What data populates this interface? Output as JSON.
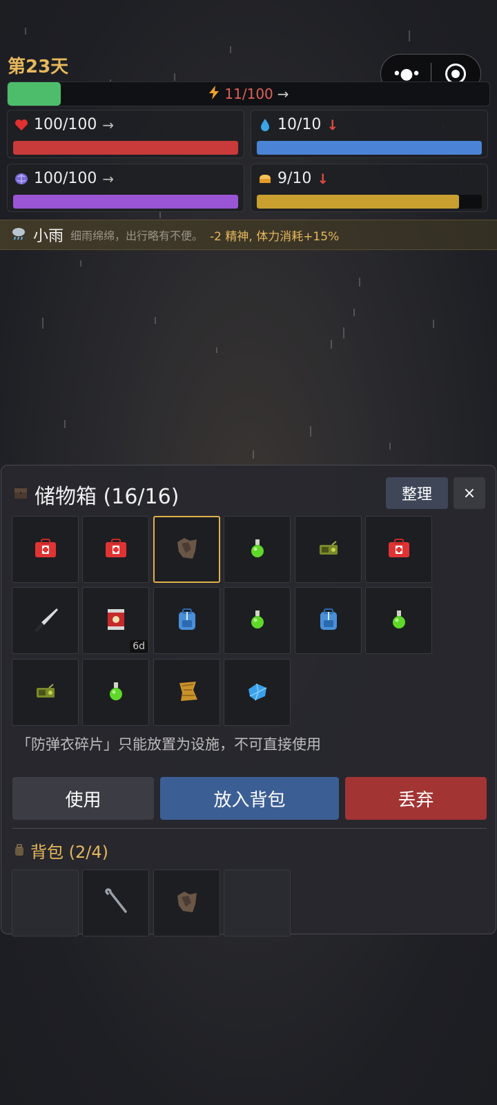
{
  "hud": {
    "day": "第23天",
    "energy": {
      "text": "11/100",
      "arrow": "→",
      "fraction": 0.11
    },
    "stats": [
      {
        "icon": "heart-icon",
        "text": "100/100",
        "dir": "→",
        "fraction": 1.0,
        "color": "#c93a3a"
      },
      {
        "icon": "water-drop-icon",
        "text": "10/10",
        "dir": "↓",
        "fraction": 1.0,
        "color": "#4b84d6"
      },
      {
        "icon": "brain-icon",
        "text": "100/100",
        "dir": "→",
        "fraction": 1.0,
        "color": "#9a55d4"
      },
      {
        "icon": "bread-icon",
        "text": "9/10",
        "dir": "↓",
        "fraction": 0.9,
        "color": "#c9a030"
      }
    ]
  },
  "capsule": {
    "more": "•●•"
  },
  "weather": {
    "icon": "rain-cloud-icon",
    "name": "小雨",
    "desc": "细雨绵绵，出行略有不便。",
    "effect": "-2 精神, 体力消耗+15%"
  },
  "storage": {
    "title": "储物箱 (16/16)",
    "sort_label": "整理",
    "close_label": "×",
    "items": [
      {
        "icon": "medkit-icon"
      },
      {
        "icon": "medkit-icon"
      },
      {
        "icon": "vest-fragment-icon",
        "selected": true
      },
      {
        "icon": "green-potion-icon"
      },
      {
        "icon": "radio-icon"
      },
      {
        "icon": "medkit-icon"
      },
      {
        "icon": "knife-icon"
      },
      {
        "icon": "canned-food-icon",
        "badge": "6d"
      },
      {
        "icon": "backpack-icon"
      },
      {
        "icon": "green-potion-icon"
      },
      {
        "icon": "backpack-icon"
      },
      {
        "icon": "green-potion-icon"
      },
      {
        "icon": "radio-icon"
      },
      {
        "icon": "green-potion-icon"
      },
      {
        "icon": "map-scrap-icon"
      },
      {
        "icon": "blue-crystal-icon"
      }
    ],
    "hint": "「防弹衣碎片」只能放置为设施，不可直接使用",
    "use_label": "使用",
    "to_bag_label": "放入背包",
    "drop_label": "丢弃"
  },
  "bag": {
    "title": "背包 (2/4)",
    "slots": [
      {
        "icon": ""
      },
      {
        "icon": "crowbar-icon"
      },
      {
        "icon": "vest-fragment-icon"
      },
      {
        "icon": ""
      }
    ]
  }
}
